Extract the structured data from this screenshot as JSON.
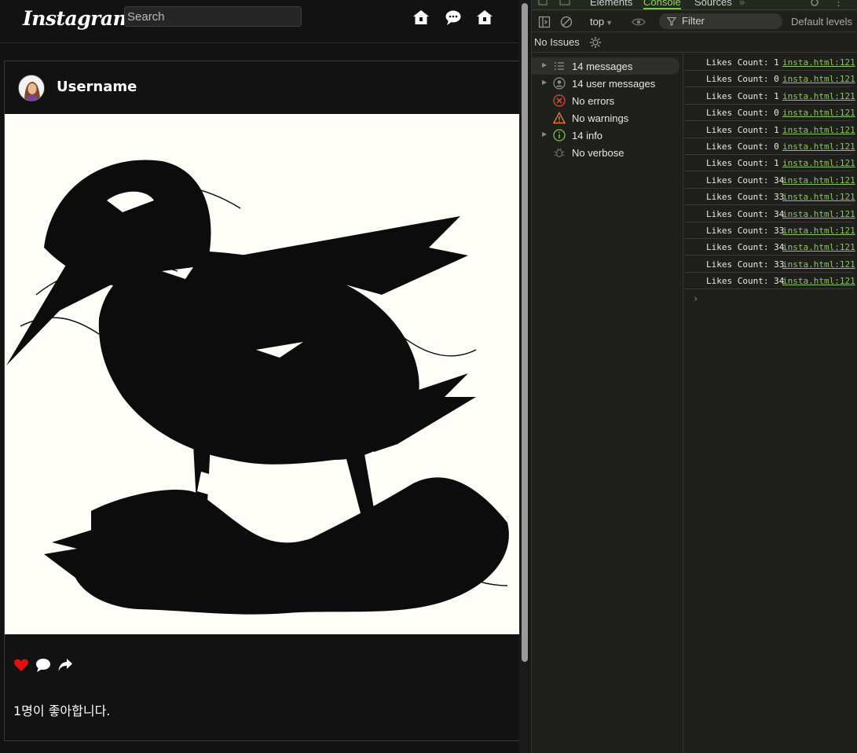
{
  "app": {
    "logo": "Instagram",
    "search": {
      "placeholder": "Search",
      "value": ""
    },
    "nav_icons": [
      "home-icon",
      "message-icon",
      "home-icon"
    ]
  },
  "post": {
    "username": "Username",
    "action_icons": [
      "heart-icon",
      "comment-icon",
      "share-icon"
    ],
    "heart_color": "#e01010",
    "likes_text": "1명이 좋아합니다."
  },
  "devtools": {
    "tabs": [
      "Elements",
      "Console",
      "Sources"
    ],
    "active_tab": "Console",
    "context": "top",
    "filter_placeholder": "Filter",
    "levels": "Default levels",
    "issues": "No Issues",
    "sidebar": [
      {
        "label": "14 messages",
        "icon": "list-icon",
        "expandable": true,
        "selected": true
      },
      {
        "label": "14 user messages",
        "icon": "user-icon",
        "expandable": true,
        "selected": false
      },
      {
        "label": "No errors",
        "icon": "error-icon",
        "expandable": false,
        "selected": false
      },
      {
        "label": "No warnings",
        "icon": "warning-icon",
        "expandable": false,
        "selected": false
      },
      {
        "label": "14 info",
        "icon": "info-icon",
        "expandable": true,
        "selected": false
      },
      {
        "label": "No verbose",
        "icon": "bug-icon",
        "expandable": false,
        "selected": false
      }
    ],
    "log_source": "insta.html:121",
    "logs": [
      "Likes Count: 1",
      "Likes Count: 0",
      "Likes Count: 1",
      "Likes Count: 0",
      "Likes Count: 1",
      "Likes Count: 0",
      "Likes Count: 1",
      "Likes Count: 34",
      "Likes Count: 33",
      "Likes Count: 34",
      "Likes Count: 33",
      "Likes Count: 34",
      "Likes Count: 33",
      "Likes Count: 34"
    ],
    "prompt": "›",
    "colors": {
      "accent": "#7cc24f",
      "link": "#8fc06a",
      "error": "#e5483c",
      "warning": "#e8883a",
      "info": "#7cc24f"
    }
  }
}
